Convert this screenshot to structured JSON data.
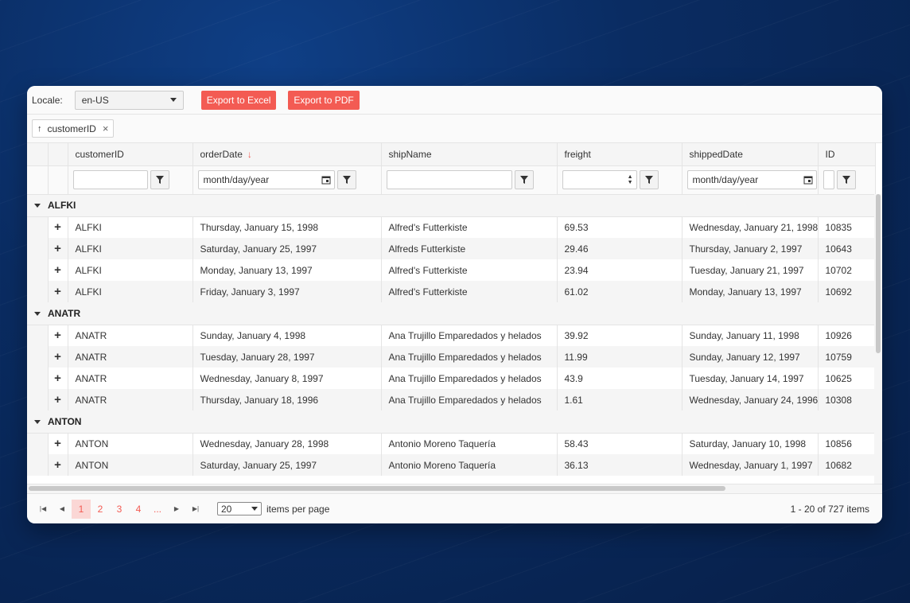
{
  "toolbar": {
    "locale_label": "Locale:",
    "locale_value": "en-US",
    "export_excel": "Export to Excel",
    "export_pdf": "Export to PDF"
  },
  "group_panel": {
    "chip_label": "customerID",
    "chip_sort_icon": "arrow-up-icon",
    "chip_close": "×"
  },
  "columns": [
    "customerID",
    "orderDate",
    "shipName",
    "freight",
    "shippedDate",
    "ID"
  ],
  "sorted_column": "orderDate",
  "sort_direction": "descending",
  "filters": {
    "orderDate_placeholder": "month/day/year",
    "shippedDate_placeholder": "month/day/year"
  },
  "groups": [
    {
      "key": "ALFKI",
      "rows": [
        [
          "ALFKI",
          "Thursday, January 15, 1998",
          "Alfred's Futterkiste",
          "69.53",
          "Wednesday, January 21, 1998",
          "10835"
        ],
        [
          "ALFKI",
          "Saturday, January 25, 1997",
          "Alfreds Futterkiste",
          "29.46",
          "Thursday, January 2, 1997",
          "10643"
        ],
        [
          "ALFKI",
          "Monday, January 13, 1997",
          "Alfred's Futterkiste",
          "23.94",
          "Tuesday, January 21, 1997",
          "10702"
        ],
        [
          "ALFKI",
          "Friday, January 3, 1997",
          "Alfred's Futterkiste",
          "61.02",
          "Monday, January 13, 1997",
          "10692"
        ]
      ]
    },
    {
      "key": "ANATR",
      "rows": [
        [
          "ANATR",
          "Sunday, January 4, 1998",
          "Ana Trujillo Emparedados y helados",
          "39.92",
          "Sunday, January 11, 1998",
          "10926"
        ],
        [
          "ANATR",
          "Tuesday, January 28, 1997",
          "Ana Trujillo Emparedados y helados",
          "11.99",
          "Sunday, January 12, 1997",
          "10759"
        ],
        [
          "ANATR",
          "Wednesday, January 8, 1997",
          "Ana Trujillo Emparedados y helados",
          "43.9",
          "Tuesday, January 14, 1997",
          "10625"
        ],
        [
          "ANATR",
          "Thursday, January 18, 1996",
          "Ana Trujillo Emparedados y helados",
          "1.61",
          "Wednesday, January 24, 1996",
          "10308"
        ]
      ]
    },
    {
      "key": "ANTON",
      "rows": [
        [
          "ANTON",
          "Wednesday, January 28, 1998",
          "Antonio Moreno Taquería",
          "58.43",
          "Saturday, January 10, 1998",
          "10856"
        ],
        [
          "ANTON",
          "Saturday, January 25, 1997",
          "Antonio Moreno Taquería",
          "36.13",
          "Wednesday, January 1, 1997",
          "10682"
        ]
      ]
    }
  ],
  "pager": {
    "pages": [
      "1",
      "2",
      "3",
      "4",
      "..."
    ],
    "current_page": "1",
    "page_size": "20",
    "items_per_page_label": "items per page",
    "info": "1 - 20 of 727 items"
  },
  "colors": {
    "accent": "#f35b53",
    "active_page_bg": "#fbd7d5"
  }
}
